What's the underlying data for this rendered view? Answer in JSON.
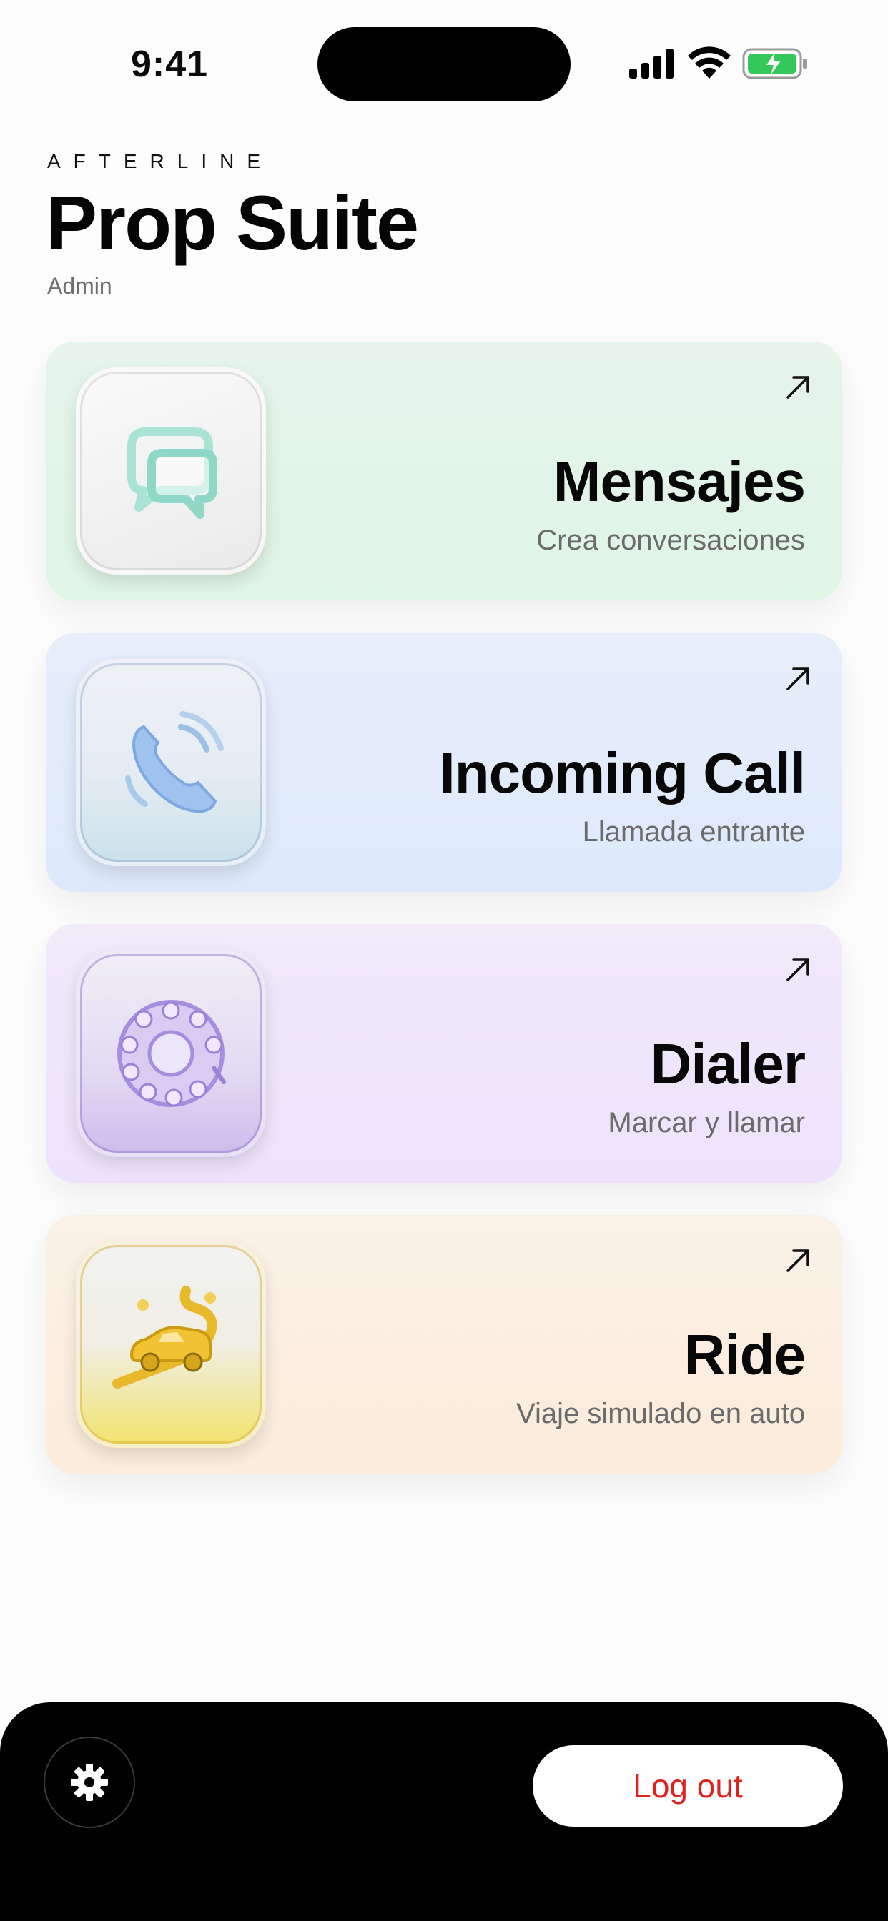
{
  "status_bar": {
    "time": "9:41",
    "icons": [
      "cellular-signal-icon",
      "wifi-icon",
      "battery-charging-icon"
    ],
    "battery_color": "#34c759"
  },
  "header": {
    "brand": "AFTERLINE",
    "title": "Prop Suite",
    "role": "Admin"
  },
  "cards": [
    {
      "title": "Mensajes",
      "subtitle": "Crea conversaciones",
      "icon": "chat-bubbles-icon",
      "arrow_icon": "arrow-up-right-icon",
      "color": "#dff5e5"
    },
    {
      "title": "Incoming Call",
      "subtitle": "Llamada entrante",
      "icon": "phone-ringing-icon",
      "arrow_icon": "arrow-up-right-icon",
      "color": "#dde9fb"
    },
    {
      "title": "Dialer",
      "subtitle": "Marcar y llamar",
      "icon": "rotary-dial-icon",
      "arrow_icon": "arrow-up-right-icon",
      "color": "#ede2fc"
    },
    {
      "title": "Ride",
      "subtitle": "Viaje simulado en auto",
      "icon": "car-route-icon",
      "arrow_icon": "arrow-up-right-icon",
      "color": "#fbecdb"
    }
  ],
  "bottom_bar": {
    "settings_icon": "gear-icon",
    "logout_label": "Log out",
    "logout_color": "#e0211c"
  }
}
